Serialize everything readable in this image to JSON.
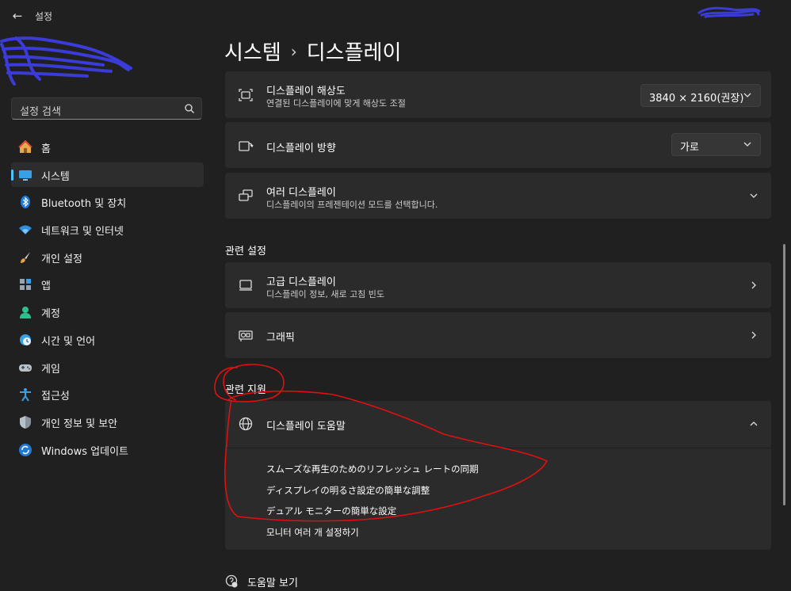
{
  "window": {
    "title": "설정"
  },
  "search": {
    "placeholder": "설정 검색"
  },
  "sidebar": {
    "items": [
      {
        "label": "홈",
        "icon": "home-icon",
        "active": false
      },
      {
        "label": "시스템",
        "icon": "system-icon",
        "active": true
      },
      {
        "label": "Bluetooth 및 장치",
        "icon": "bluetooth-icon",
        "active": false
      },
      {
        "label": "네트워크 및 인터넷",
        "icon": "wifi-icon",
        "active": false
      },
      {
        "label": "개인 설정",
        "icon": "paintbrush-icon",
        "active": false
      },
      {
        "label": "앱",
        "icon": "apps-icon",
        "active": false
      },
      {
        "label": "계정",
        "icon": "account-icon",
        "active": false
      },
      {
        "label": "시간 및 언어",
        "icon": "clock-globe-icon",
        "active": false
      },
      {
        "label": "게임",
        "icon": "gamepad-icon",
        "active": false
      },
      {
        "label": "접근성",
        "icon": "accessibility-icon",
        "active": false
      },
      {
        "label": "개인 정보 및 보안",
        "icon": "shield-icon",
        "active": false
      },
      {
        "label": "Windows 업데이트",
        "icon": "update-icon",
        "active": false
      }
    ]
  },
  "breadcrumb": {
    "parent": "시스템",
    "separator": "›",
    "current": "디스플레이"
  },
  "settings": {
    "resolution": {
      "title": "디스플레이 해상도",
      "subtitle": "연결된 디스플레이에 맞게 해상도 조절",
      "value": "3840 × 2160(권장)"
    },
    "orientation": {
      "title": "디스플레이 방향",
      "value": "가로"
    },
    "multiple": {
      "title": "여러 디스플레이",
      "subtitle": "디스플레이의 프레젠테이션 모드를 선택합니다."
    }
  },
  "related_settings": {
    "heading": "관련 설정",
    "advanced": {
      "title": "고급 디스플레이",
      "subtitle": "디스플레이 정보, 새로 고침 빈도"
    },
    "graphics": {
      "title": "그래픽"
    }
  },
  "related_support": {
    "heading": "관련 지원",
    "help": {
      "title": "디스플레이 도움말"
    },
    "links": [
      "スムーズな再生のためのリフレッシュ レートの同期",
      "ディスプレイの明るさ設定の簡単な調整",
      "デュアル モニターの簡単な設定",
      "모니터 여러 개 설정하기"
    ]
  },
  "footer": {
    "get_help": "도움말 보기"
  },
  "colors": {
    "accent": "#4cc2ff",
    "background": "#202020",
    "card": "#2b2b2b",
    "annotation": "#e01010",
    "scribble": "#3b3bd8"
  }
}
